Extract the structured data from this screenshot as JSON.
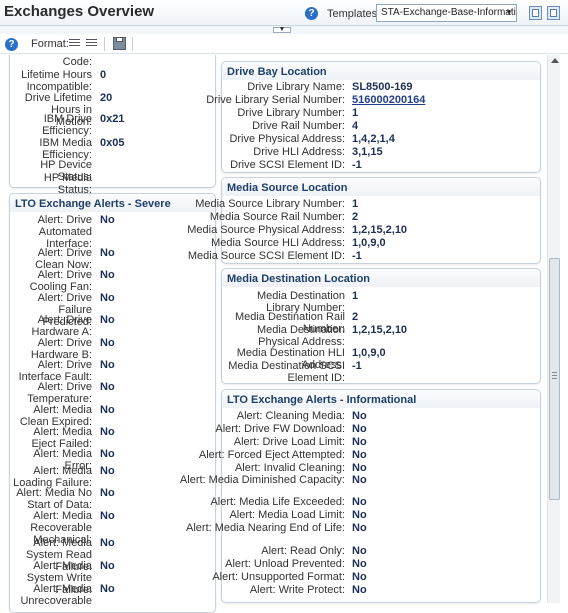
{
  "header": {
    "title": "Exchanges Overview",
    "templates_label": "Templates:",
    "template_selected": "STA-Exchange-Base-Information"
  },
  "toolbar": {
    "format_label": "Format:"
  },
  "left_top_panel": {
    "rows": [
      {
        "label": "Code:",
        "value": ""
      },
      {
        "label": "Lifetime Hours Incompatible:",
        "value": "0"
      },
      {
        "label": "Drive Lifetime Hours in Motion:",
        "value": "20"
      },
      {
        "label": "IBM Drive Efficiency:",
        "value": "0x21"
      },
      {
        "label": "IBM Media Efficiency:",
        "value": "0x05"
      },
      {
        "label": "HP Device Status:",
        "value": ""
      },
      {
        "label": "HP Media Status:",
        "value": ""
      }
    ]
  },
  "lto_severe": {
    "title": "LTO Exchange Alerts - Severe",
    "rows": [
      {
        "label": "Alert: Drive Automated Interface:",
        "value": "No"
      },
      {
        "label": "Alert: Drive Clean Now:",
        "value": "No"
      },
      {
        "label": "Alert: Drive Cooling Fan:",
        "value": "No"
      },
      {
        "label": "Alert: Drive Failure Predicted:",
        "value": "No"
      },
      {
        "label": "Alert: Drive Hardware A:",
        "value": "No"
      },
      {
        "label": "Alert: Drive Hardware B:",
        "value": "No"
      },
      {
        "label": "Alert: Drive Interface Fault:",
        "value": "No"
      },
      {
        "label": "Alert: Drive Temperature:",
        "value": "No"
      },
      {
        "label": "Alert: Media Clean Expired:",
        "value": "No"
      },
      {
        "label": "Alert: Media Eject Failed:",
        "value": "No"
      },
      {
        "label": "Alert: Media Error:",
        "value": "No"
      },
      {
        "label": "Alert: Media Loading Failure:",
        "value": "No"
      },
      {
        "label": "Alert: Media No Start of Data:",
        "value": "No"
      },
      {
        "label": "Alert: Media Recoverable Mechanical:",
        "value": "No"
      },
      {
        "label": "Alert: Media System Read Failure:",
        "value": "No"
      },
      {
        "label": "Alert: Media System Write Failure:",
        "value": "No"
      },
      {
        "label": "Alert: Media Unrecoverable",
        "value": "No"
      }
    ]
  },
  "drive_bay": {
    "title": "Drive Bay Location",
    "rows": [
      {
        "label": "Drive Library Name:",
        "value": "SL8500-169"
      },
      {
        "label": "Drive Library Serial Number:",
        "value": "516000200164"
      },
      {
        "label": "Drive Library Number:",
        "value": "1"
      },
      {
        "label": "Drive Rail Number:",
        "value": "4"
      },
      {
        "label": "Drive Physical Address:",
        "value": "1,4,2,1,4"
      },
      {
        "label": "Drive HLI Address:",
        "value": "3,1,15"
      },
      {
        "label": "Drive SCSI Element ID:",
        "value": "-1"
      }
    ]
  },
  "media_source": {
    "title": "Media Source Location",
    "rows": [
      {
        "label": "Media Source Library Number:",
        "value": "1"
      },
      {
        "label": "Media Source Rail Number:",
        "value": "2"
      },
      {
        "label": "Media Source Physical Address:",
        "value": "1,2,15,2,10"
      },
      {
        "label": "Media Source HLI Address:",
        "value": "1,0,9,0"
      },
      {
        "label": "Media Source SCSI Element ID:",
        "value": "-1"
      }
    ]
  },
  "media_dest": {
    "title": "Media Destination Location",
    "rows": [
      {
        "label": "Media Destination Library Number:",
        "value": "1"
      },
      {
        "label": "Media Destination Rail Number:",
        "value": "2"
      },
      {
        "label": "Media Destination Physical Address:",
        "value": "1,2,15,2,10"
      },
      {
        "label": "Media Destination HLI Address:",
        "value": "1,0,9,0"
      },
      {
        "label": "Media Destination SCSI Element ID:",
        "value": "-1"
      }
    ]
  },
  "lto_info": {
    "title": "LTO Exchange Alerts - Informational",
    "rows": [
      {
        "label": "Alert: Cleaning Media:",
        "value": "No"
      },
      {
        "label": "Alert: Drive FW Download:",
        "value": "No"
      },
      {
        "label": "Alert: Drive Load Limit:",
        "value": "No"
      },
      {
        "label": "Alert: Forced Eject Attempted:",
        "value": "No"
      },
      {
        "label": "Alert: Invalid Cleaning:",
        "value": "No"
      },
      {
        "label": "Alert: Media Diminished Capacity:",
        "value": "No"
      },
      {
        "label": "Alert: Media Life Exceeded:",
        "value": "No"
      },
      {
        "label": "Alert: Media Load Limit:",
        "value": "No"
      },
      {
        "label": "Alert: Media Nearing End of Life:",
        "value": "No"
      },
      {
        "label": "Alert: Read Only:",
        "value": "No"
      },
      {
        "label": "Alert: Unload Prevented:",
        "value": "No"
      },
      {
        "label": "Alert: Unsupported Format:",
        "value": "No"
      },
      {
        "label": "Alert: Write Protect:",
        "value": "No"
      }
    ]
  }
}
